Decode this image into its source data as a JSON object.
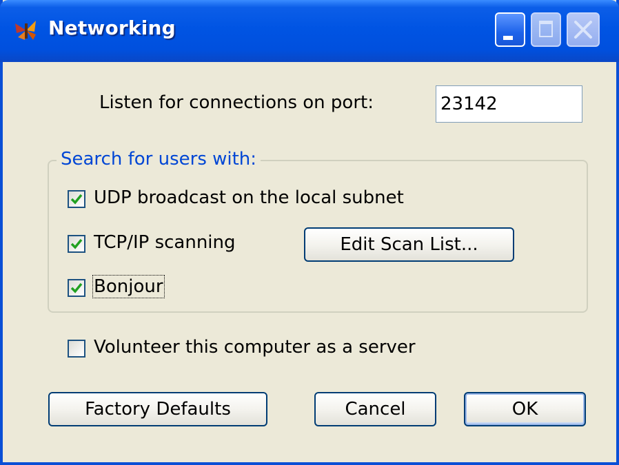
{
  "window": {
    "title": "Networking",
    "controls": {
      "minimize": "minimize",
      "maximize": "maximize",
      "close": "close"
    }
  },
  "port": {
    "label": "Listen for connections on port:",
    "value": "23142"
  },
  "search": {
    "legend": "Search for users with:",
    "udp": {
      "label": "UDP broadcast on the local subnet",
      "checked": true
    },
    "tcp": {
      "label": "TCP/IP scanning",
      "checked": true
    },
    "bonjour": {
      "label": "Bonjour",
      "checked": true
    },
    "edit_scan_list_label": "Edit Scan List..."
  },
  "volunteer": {
    "label": "Volunteer this computer as a server",
    "checked": false
  },
  "buttons": {
    "factory_defaults": "Factory Defaults",
    "cancel": "Cancel",
    "ok": "OK"
  },
  "colors": {
    "titlebar": "#0054e3",
    "dialog_bg": "#ece9d8",
    "group_legend": "#0046d5",
    "check_mark": "#21a121"
  },
  "icons": {
    "app": "butterfly-app-icon",
    "minimize": "minimize-icon",
    "maximize": "maximize-icon",
    "close": "close-icon",
    "check": "checkmark-icon"
  }
}
